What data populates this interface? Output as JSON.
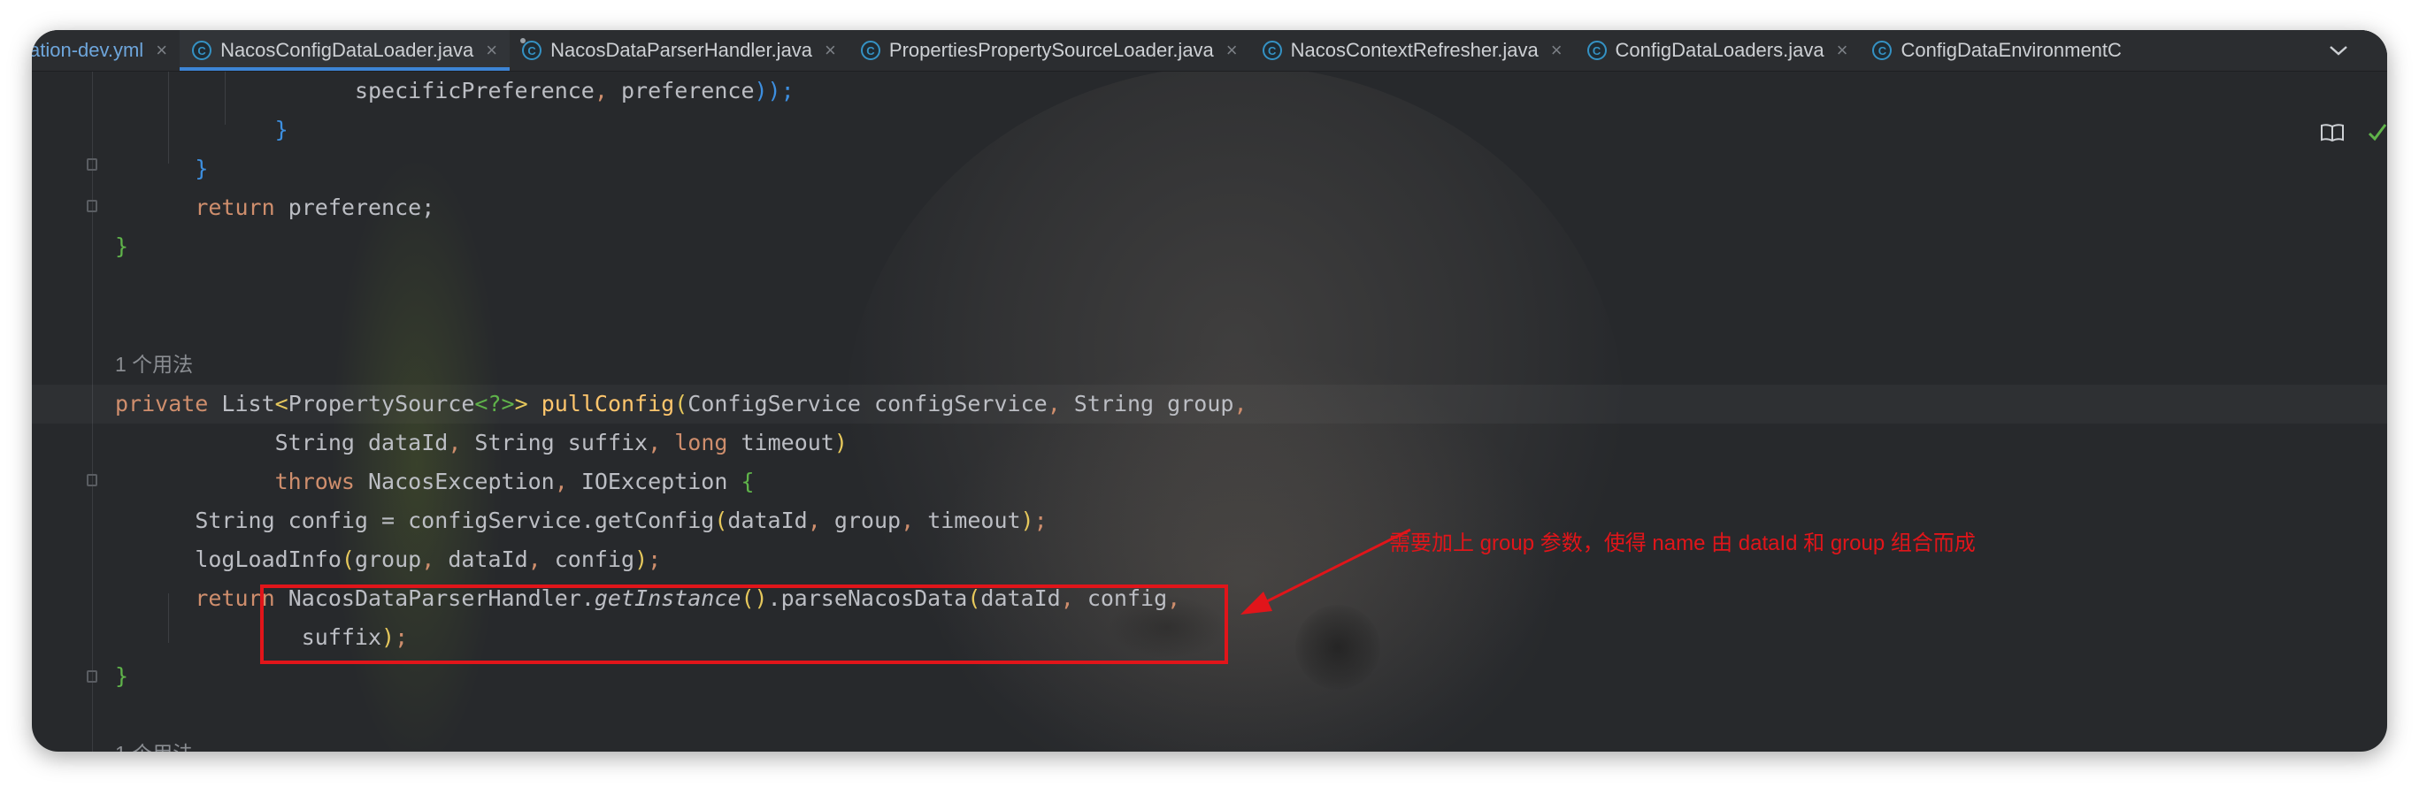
{
  "tabs": [
    {
      "name": "cation-dev.yml",
      "icon": "yaml-file-icon",
      "active": false
    },
    {
      "name": "NacosConfigDataLoader.java",
      "icon": "java-class-icon",
      "active": true
    },
    {
      "name": "NacosDataParserHandler.java",
      "icon": "java-class-icon",
      "active": false
    },
    {
      "name": "PropertiesPropertySourceLoader.java",
      "icon": "java-class-icon",
      "active": false
    },
    {
      "name": "NacosContextRefresher.java",
      "icon": "java-class-icon",
      "active": false
    },
    {
      "name": "ConfigDataLoaders.java",
      "icon": "java-class-icon",
      "active": false
    },
    {
      "name": "ConfigDataEnvironmentC",
      "icon": "java-class-icon",
      "active": false
    }
  ],
  "tab_close_glyph": "×",
  "class_icon_letter": "C",
  "tabs_menu_glyph": "⌵",
  "code": {
    "l1_a": "specificPreference",
    "l1_b": "preference",
    "l1_c": "));",
    "brace_close": "}",
    "return_kw": "return",
    "preference": "preference;",
    "usage_hint": "1 个用法",
    "private_kw": "private",
    "list_type": "List",
    "ps_type": "PropertySource",
    "wildcard": "<?>",
    "method_name": "pullConfig",
    "p1_type": "ConfigService",
    "p1_name": "configService",
    "p2_type": "String",
    "p2_name": "group",
    "p3_type": "String",
    "p3_name": "dataId",
    "p4_type": "String",
    "p4_name": "suffix",
    "p5_type": "long",
    "p5_name": "timeout",
    "throws_kw": "throws",
    "ex1": "NacosException",
    "ex2": "IOException",
    "open_brace": "{",
    "s1_decl": "String config = configService.",
    "s1_call": "getConfig",
    "s1_args": "dataId",
    "s1_args2": "group",
    "s1_args3": "timeout",
    "s2_call": "logLoadInfo",
    "s2_a1": "group",
    "s2_a2": "dataId",
    "s2_a3": "config",
    "ret_cls": "NacosDataParserHandler.",
    "ret_inst": "getInstance",
    "ret_call": ".parseNacosData",
    "ret_a1": "dataId",
    "ret_a2": "config",
    "ret_a3": "suffix"
  },
  "annotation_text": "需要加上 group 参数，使得 name 由 dataId 和 group 组合而成",
  "colors": {
    "annotation_red": "#e1151a",
    "keyword": "#cf8e6d",
    "method_decl": "#ffc66d",
    "tab_accent": "#3d85d6"
  }
}
